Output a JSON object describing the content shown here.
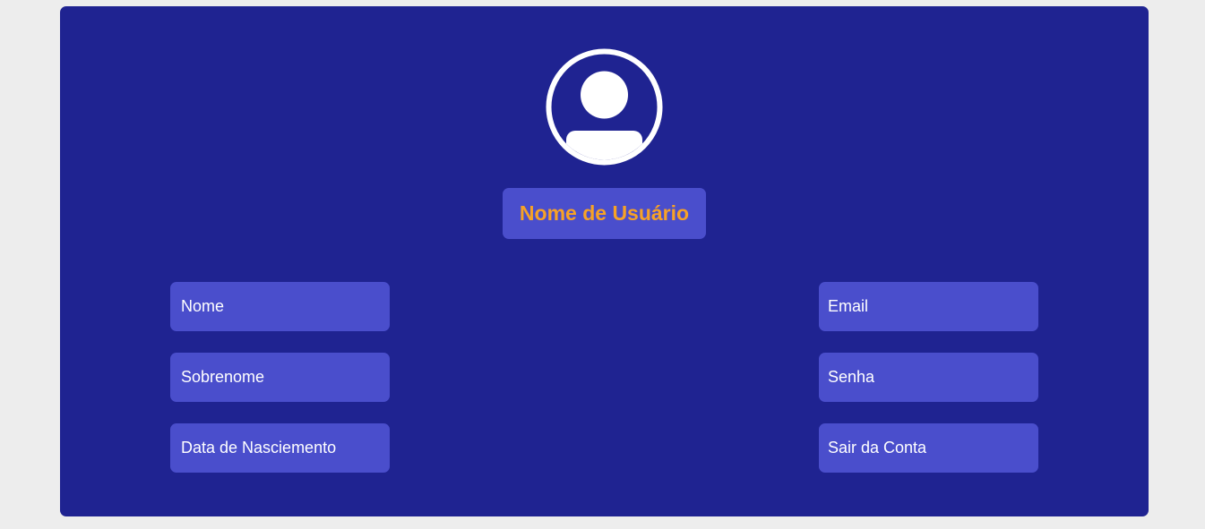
{
  "profile": {
    "avatar_icon": "user-avatar-icon",
    "username": "Nome de Usuário"
  },
  "fields_left": [
    "Nome",
    "Sobrenome",
    "Data de Nasciemento"
  ],
  "fields_right": [
    "Email",
    "Senha",
    "Sair da Conta"
  ],
  "colors": {
    "page_bg": "#ededed",
    "card_bg": "#1f2391",
    "field_bg": "#4a4ecc",
    "username_text": "#f7a226",
    "field_text": "#ffffff"
  }
}
